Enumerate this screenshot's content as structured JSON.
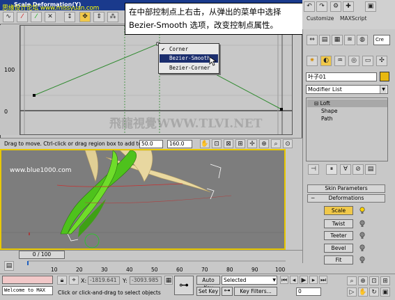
{
  "watermark": {
    "top": "思缘设计论坛 www.missyuan.com",
    "mid": "www.blue1000.com",
    "graph": "飛龍視覺WWW.TLVI.NET"
  },
  "deform_window": {
    "title": "Scale Deformation(Y)",
    "y_labels": [
      "100",
      "0"
    ],
    "status_text": "Drag to move. Ctrl-click or drag region box to add to s",
    "field_a": "50.0",
    "field_b": "160.0"
  },
  "context_menu": {
    "items": [
      {
        "label": "Corner",
        "checked": true
      },
      {
        "label": "Bezier-Smooth",
        "active": true
      },
      {
        "label": "Bezier-Corner"
      }
    ]
  },
  "callout": {
    "text": "在中部控制点上右击，从弹出的菜单中选择 Bezier-Smooth 选项，改变控制点属性。"
  },
  "command_panel": {
    "toolbar_labels": [
      "Customize",
      "MAXScript"
    ],
    "object_name": "叶子01",
    "modifier_list": "Modifier List",
    "stack": [
      "Loft",
      "Shape",
      "Path"
    ],
    "rollouts": [
      "Skin Parameters",
      "Deformations"
    ],
    "deform_buttons": [
      "Scale",
      "Twist",
      "Teeter",
      "Bevel",
      "Fit"
    ],
    "tab_hint": "Cre"
  },
  "time": {
    "slider": "0 / 100",
    "ticks": [
      "10",
      "20",
      "30",
      "40",
      "50",
      "60",
      "70",
      "80",
      "90",
      "100"
    ]
  },
  "status": {
    "welcome": "Welcome to MAX",
    "x_label": "X:",
    "x_value": "-1819.641",
    "y_label": "Y:",
    "y_value": "-3093.985",
    "prompt": "Click or click-and-drag to select objects",
    "auto_key": "Auto Key",
    "set_key": "Set Key",
    "selected": "Selected",
    "key_filters": "Key Filters...",
    "frame": "0"
  },
  "colors": {
    "title_bar": "#1a3a8c",
    "menu_active": "#1b2e6e",
    "viewport_border": "#e8c800",
    "curve": "#2f8a2f"
  }
}
